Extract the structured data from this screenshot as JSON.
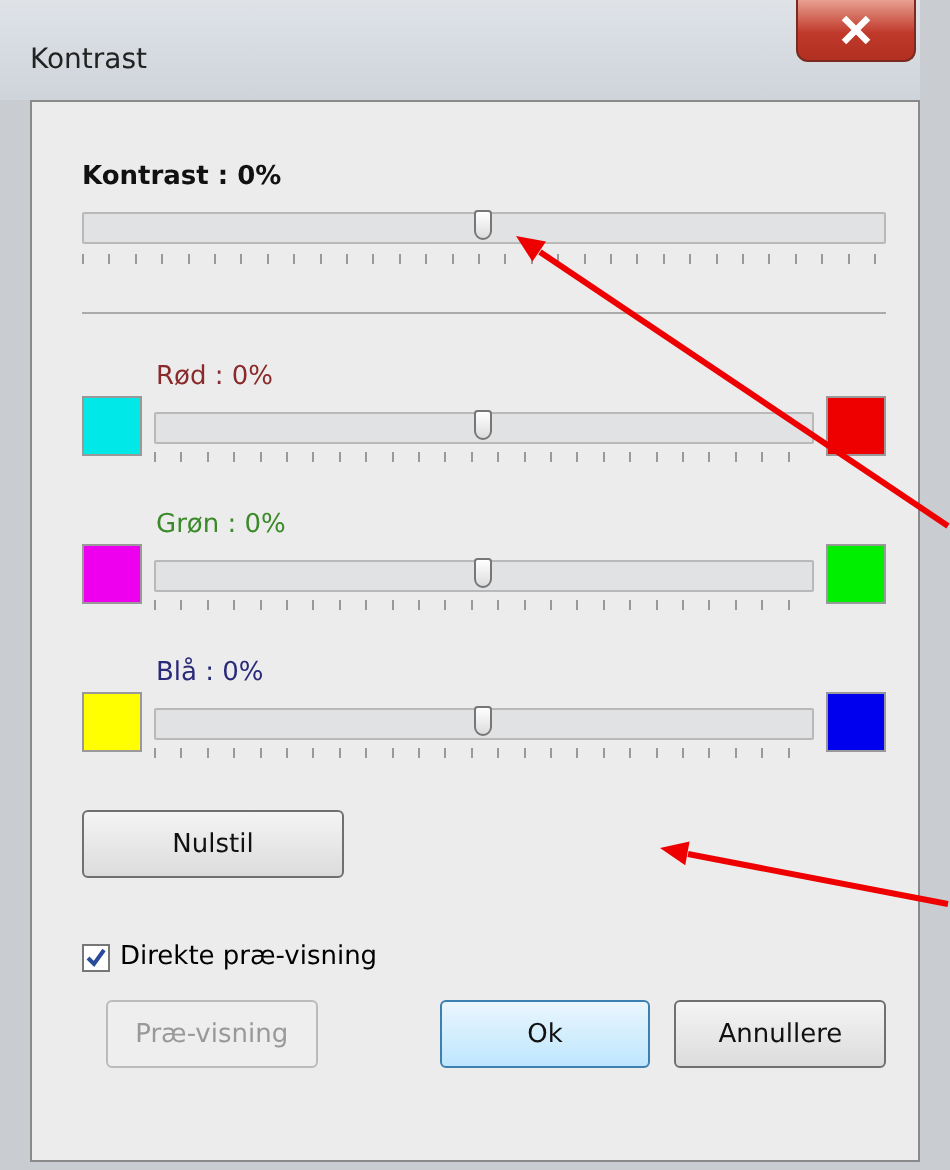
{
  "window": {
    "title": "Kontrast"
  },
  "main_slider": {
    "label": "Kontrast : 0%",
    "level": 0.5
  },
  "color_sliders": [
    {
      "label": "Rød : 0%",
      "color": "#8a2a2a",
      "swatches": [
        {
          "color": "#00e8e8"
        },
        {
          "color": "#ee0000"
        }
      ],
      "level": 0.5
    },
    {
      "label": "Grøn : 0%",
      "color": "#3a8a2a",
      "swatches": [
        {
          "color": "#ee00ee"
        },
        {
          "color": "#00ee00"
        }
      ],
      "level": 0.5
    },
    {
      "label": "Blå : 0%",
      "color": "#2a2a7a",
      "swatches": [
        {
          "color": "#ffff00"
        },
        {
          "color": "#0000ee"
        }
      ],
      "level": 0.5
    }
  ],
  "reset_button": "Nulstil",
  "live_preview": {
    "label": "Direkte præ-visning",
    "checked": true
  },
  "buttons": [
    {
      "label": "Præ-visning",
      "disabled": true,
      "default": false
    },
    {
      "label": "Ok",
      "disabled": false,
      "default": true
    },
    {
      "label": "Annullere",
      "disabled": false,
      "default": false
    }
  ]
}
